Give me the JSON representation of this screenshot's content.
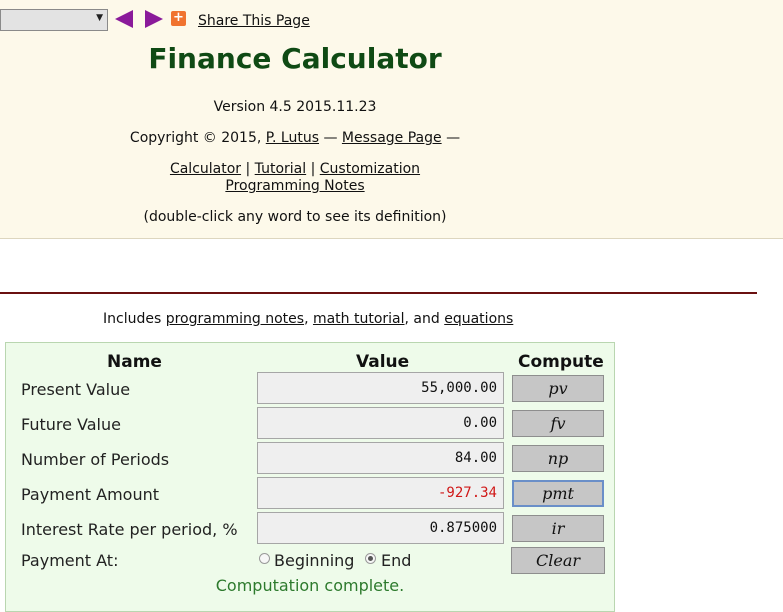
{
  "header": {
    "share_label": "Share This Page",
    "share_icon": "plus-share-icon",
    "title": "Finance Calculator",
    "version": "Version 4.5 2015.11.23",
    "copyright_prefix": "Copyright © 2015,",
    "author_link": "P. Lutus",
    "dash1": "—",
    "message_link": "Message Page",
    "dash2": "—",
    "links": {
      "calculator": "Calculator",
      "sep1": "|",
      "tutorial": "Tutorial",
      "sep2": "|",
      "customization": "Customization",
      "programming_notes": "Programming Notes"
    },
    "hint": "(double-click any word to see its definition)"
  },
  "includes": {
    "prefix": "Includes",
    "link1": "programming notes",
    "sep": ",",
    "link2": "math tutorial",
    "and": ", and",
    "link3": "equations"
  },
  "calculator": {
    "headers": {
      "name": "Name",
      "value": "Value",
      "compute": "Compute"
    },
    "rows": [
      {
        "label": "Present Value",
        "value": "55,000.00",
        "button": "pv"
      },
      {
        "label": "Future Value",
        "value": "0.00",
        "button": "fv"
      },
      {
        "label": "Number of Periods",
        "value": "84.00",
        "button": "np"
      },
      {
        "label": "Payment Amount",
        "value": "-927.34",
        "button": "pmt"
      },
      {
        "label": "Interest Rate per period, %",
        "value": "0.875000",
        "button": "ir"
      }
    ],
    "payment_at": {
      "label": "Payment At:",
      "option_beginning": "Beginning",
      "option_end": "End",
      "selected": "End"
    },
    "clear_label": "Clear",
    "status": "Computation complete."
  },
  "colors": {
    "header_bg": "#fdf9ea",
    "title": "#0f4a14",
    "calc_bg": "#eefbea",
    "negative": "#d01818",
    "status": "#2d7a2d",
    "rule": "#6a1010",
    "arrows": "#8a1a9a"
  }
}
